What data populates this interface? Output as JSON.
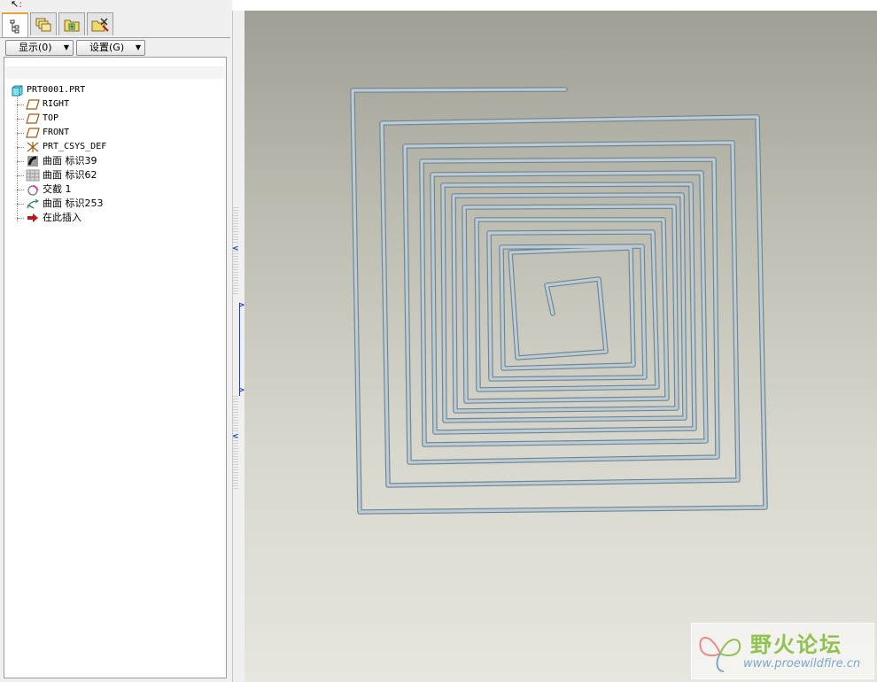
{
  "left_panel": {
    "tabs": [
      {
        "name": "model-tree-icon"
      },
      {
        "name": "layers-icon"
      },
      {
        "name": "folder-icon"
      },
      {
        "name": "favorites-folder-icon"
      }
    ],
    "buttons": {
      "show_label": "显示(0)",
      "settings_label": "设置(G)"
    },
    "tree": {
      "root": "PRT0001.PRT",
      "items": [
        {
          "label": "RIGHT",
          "icon": "datum-plane-icon"
        },
        {
          "label": "TOP",
          "icon": "datum-plane-icon"
        },
        {
          "label": "FRONT",
          "icon": "datum-plane-icon"
        },
        {
          "label": "PRT_CSYS_DEF",
          "icon": "csys-icon"
        },
        {
          "label": "曲面 标识39",
          "icon": "surface-icon"
        },
        {
          "label": "曲面 标识62",
          "icon": "surface-grid-icon"
        },
        {
          "label": "交截 1",
          "icon": "intersect-icon"
        },
        {
          "label": "曲面 标识253",
          "icon": "sweep-surface-icon"
        },
        {
          "label": "在此插入",
          "icon": "insert-here-arrow-icon"
        }
      ]
    }
  },
  "watermark": {
    "title": "野火论坛",
    "url": "www.proewildfire.cn"
  },
  "colors": {
    "wire": "#bccbd4",
    "wire_edge": "#6f8591",
    "insert_arrow": "#c0141c",
    "tab_accent": "#f0a030"
  }
}
